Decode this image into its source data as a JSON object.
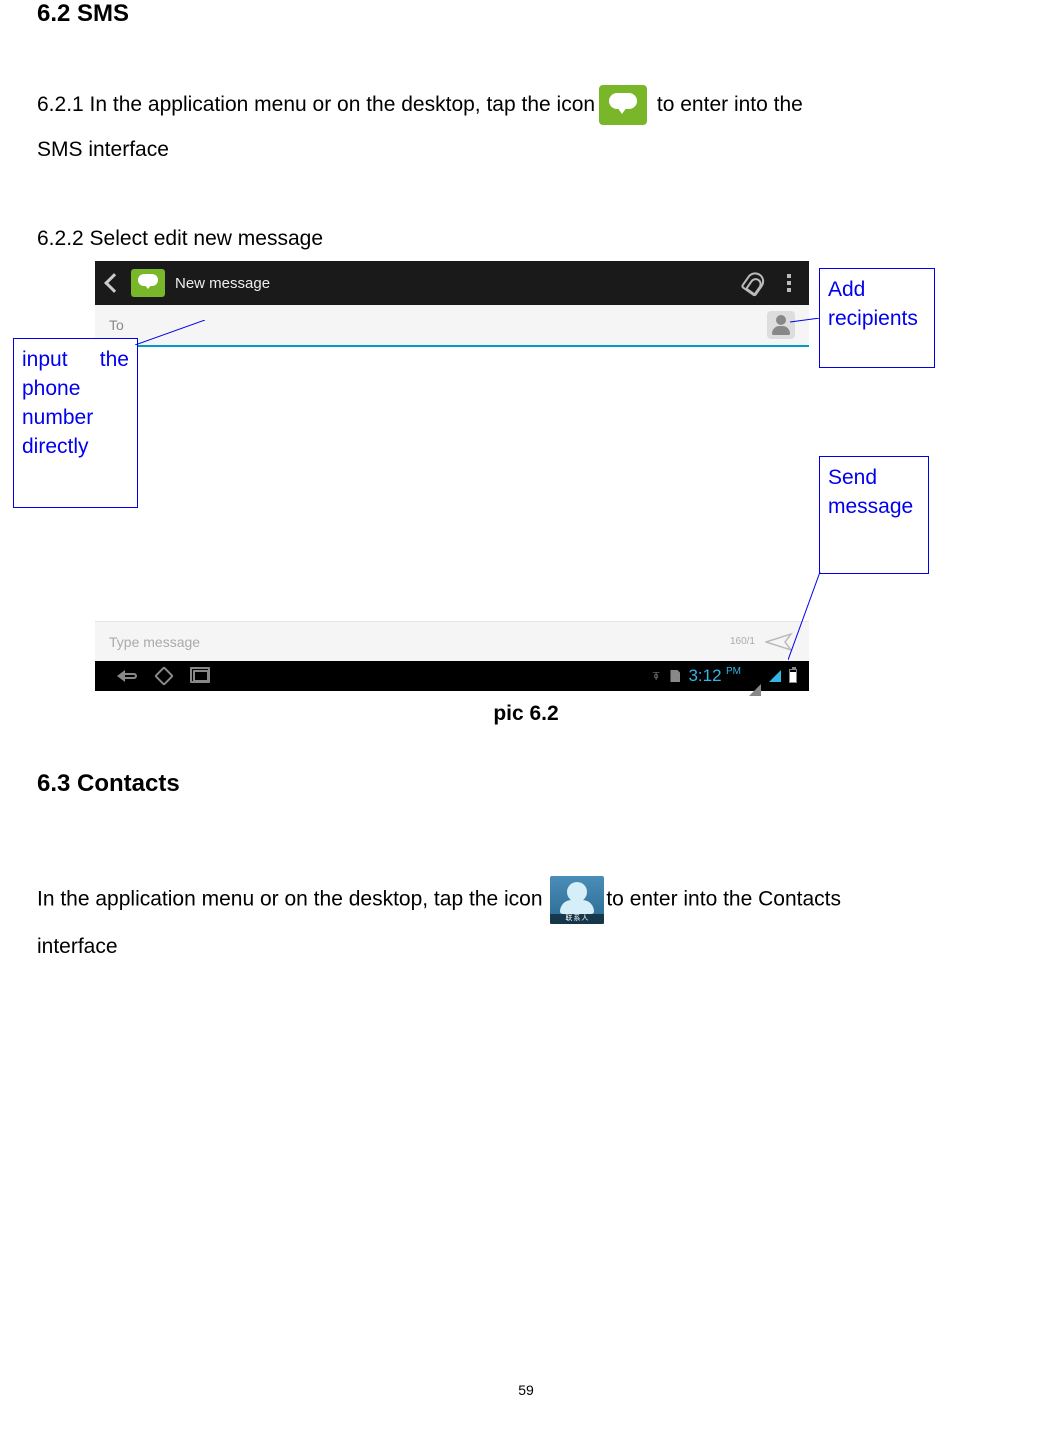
{
  "section_sms": {
    "heading": "6.2 SMS",
    "p621_prefix": "6.2.1 In the application menu or on the desktop, tap the icon",
    "p621_suffix": " to enter into the SMS interface",
    "p622": "6.2.2 Select edit new message",
    "caption": "pic 6.2"
  },
  "screenshot": {
    "title": "New message",
    "to_label": "To",
    "type_placeholder": "Type message",
    "counter": "160/1",
    "time_main": "3:12",
    "time_ampm": "PM"
  },
  "callouts": {
    "input_phone_l1a": "input",
    "input_phone_l1b": "the",
    "input_phone_l2": "phone",
    "input_phone_l3": "number",
    "input_phone_l4": "directly",
    "add_recipients_l1": "Add",
    "add_recipients_l2": "recipients",
    "send_message_l1": "Send",
    "send_message_l2": "message"
  },
  "section_contacts": {
    "heading": "6.3 Contacts",
    "p_prefix": "In the application menu or on the desktop, tap the icon ",
    "p_suffix": "to enter into the Contacts interface",
    "icon_label": "联系人"
  },
  "page_number": "59"
}
